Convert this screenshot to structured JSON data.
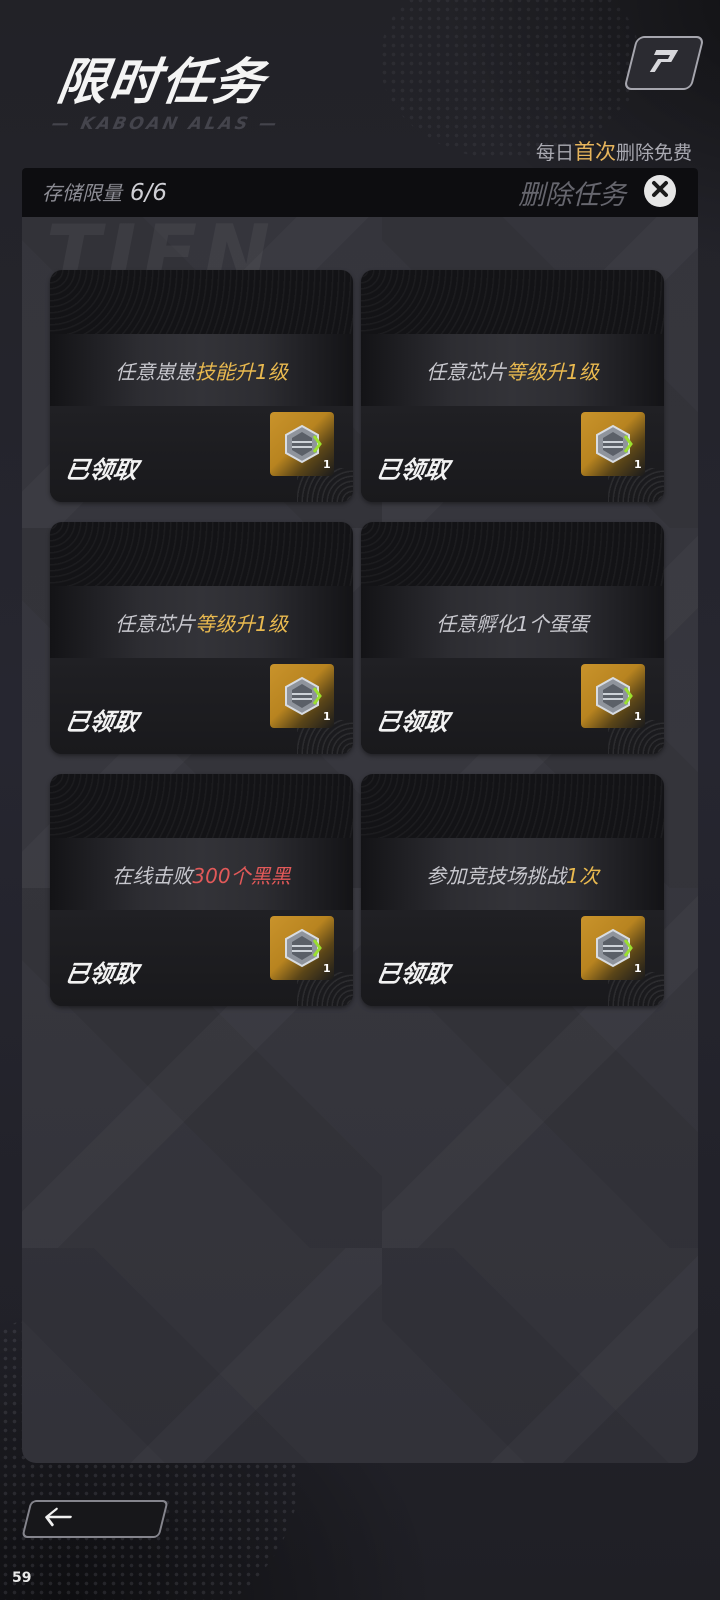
{
  "header": {
    "title": "限时任务",
    "subtitle": "— KABOAN ALAS —"
  },
  "free_note": {
    "prefix": "每日",
    "highlight": "首次",
    "suffix": "删除免费"
  },
  "panel": {
    "watermark": "TIEN",
    "storage_label": "存储限量",
    "storage_count": "6/6",
    "delete_label": "删除任务"
  },
  "tasks": [
    {
      "text_plain": "任意崽崽",
      "text_highlight": "技能升1级",
      "highlight_color": "gold",
      "status": "已领取",
      "reward_qty": "1"
    },
    {
      "text_plain": "任意芯片",
      "text_highlight": "等级升1级",
      "highlight_color": "gold",
      "status": "已领取",
      "reward_qty": "1"
    },
    {
      "text_plain": "任意芯片",
      "text_highlight": "等级升1级",
      "highlight_color": "gold",
      "status": "已领取",
      "reward_qty": "1"
    },
    {
      "text_plain": "任意孵化1个蛋蛋",
      "text_highlight": "",
      "highlight_color": "",
      "status": "已领取",
      "reward_qty": "1"
    },
    {
      "text_plain": "在线击败",
      "text_highlight": "300个黑黑",
      "highlight_color": "red",
      "status": "已领取",
      "reward_qty": "1"
    },
    {
      "text_plain": "参加竞技场挑战",
      "text_highlight": "1次",
      "highlight_color": "gold",
      "status": "已领取",
      "reward_qty": "1"
    }
  ],
  "icons": {
    "corner": "arrow-badge-icon",
    "close": "close-icon",
    "back": "arrow-left-icon",
    "reward": "chip-crystal-icon"
  },
  "colors": {
    "gold": "#e9b94f",
    "red": "#e25959",
    "panel": "#36363d"
  },
  "fps": "59"
}
